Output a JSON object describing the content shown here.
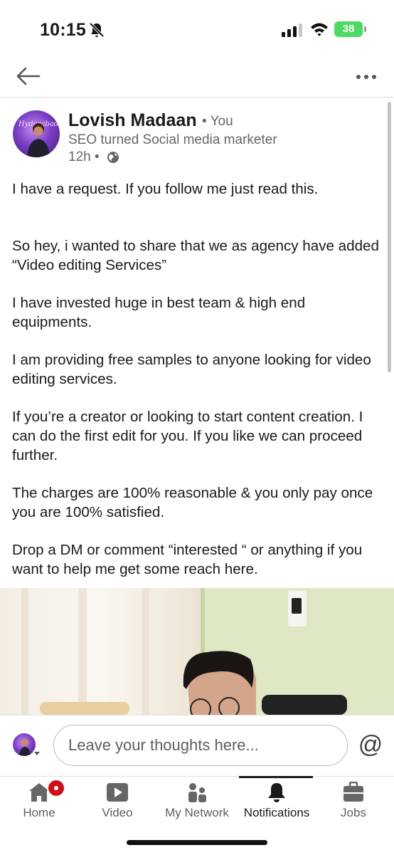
{
  "status_bar": {
    "time": "10:15",
    "battery": "38",
    "icons": [
      "bell-slash-icon",
      "cellular-signal-icon",
      "wifi-icon",
      "battery-charging-icon"
    ]
  },
  "top_nav": {
    "back_icon": "arrow-left-icon",
    "more_icon": "more-horizontal-icon"
  },
  "post": {
    "author": {
      "name": "Lovish Madaan",
      "degree": "• You",
      "headline": "SEO turned Social media marketer",
      "time_ago": "12h •",
      "visibility_icon": "globe-icon"
    },
    "paragraphs": [
      "I have a request. If you follow me just read this.",
      "So hey, i wanted to share that we as agency have added “Video editing Services”",
      "I have invested huge in best team & high end equipments.",
      "I am providing free samples to anyone looking for video editing services.",
      "If you’re a creator or looking to start content creation. I can do the first edit for you. If you like we can proceed further.",
      "The charges are 100% reasonable & you only pay once you are 100% satisfied.",
      "Drop a DM or comment “interested “ or anything if you want to help me get some reach here."
    ]
  },
  "comment_bar": {
    "placeholder": "Leave your thoughts here...",
    "mention_label": "@"
  },
  "bottom_nav": {
    "items": [
      {
        "label": "Home",
        "icon": "home-icon"
      },
      {
        "label": "Video",
        "icon": "video-play-icon"
      },
      {
        "label": "My Network",
        "icon": "people-icon"
      },
      {
        "label": "Notifications",
        "icon": "bell-icon"
      },
      {
        "label": "Jobs",
        "icon": "briefcase-icon"
      }
    ],
    "active": "Notifications"
  },
  "colors": {
    "text_primary": "#1a1a1a",
    "text_secondary": "#666666",
    "badge_red": "#cc1016",
    "battery_green": "#4cd964",
    "avatar_purple": "#7b3fc4"
  }
}
